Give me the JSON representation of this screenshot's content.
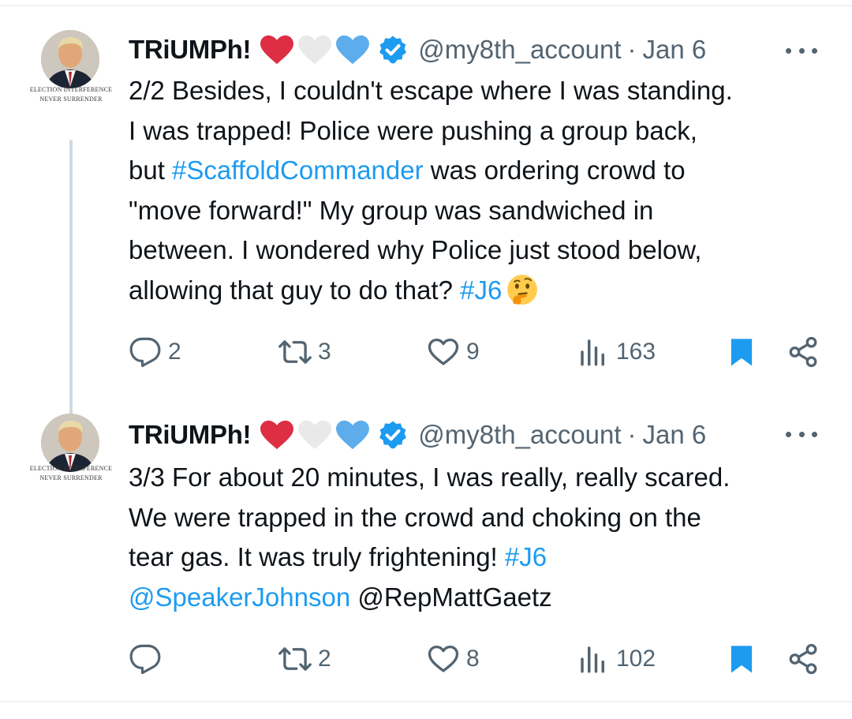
{
  "tweets": [
    {
      "display_name": "TRiUMPh!",
      "handle": "@my8th_account",
      "separator": "·",
      "date": "Jan 6",
      "avatar_caption_line1": "ELECTION INTERFERENCE",
      "avatar_caption_line2": "NEVER SURRENDER",
      "text_parts": {
        "p1": "2/2 Besides, I couldn't escape where I was standing.\nI was trapped! Police were pushing a group back,\nbut ",
        "hashtag1": "#ScaffoldCommander",
        "p2": " was ordering crowd to\n\"move forward!\" My group was sandwiched in\nbetween. I wondered why Police just stood below,\nallowing that guy to do that? ",
        "hashtag2": "#J6"
      },
      "stats": {
        "replies": "2",
        "retweets": "3",
        "likes": "9",
        "views": "163"
      }
    },
    {
      "display_name": "TRiUMPh!",
      "handle": "@my8th_account",
      "separator": "·",
      "date": "Jan 6",
      "avatar_caption_line1": "ELECTION INTERFERENCE",
      "avatar_caption_line2": "NEVER SURRENDER",
      "text_parts": {
        "p1": "3/3 For about 20 minutes, I was really, really scared.\nWe were trapped in the crowd and choking on the\ntear gas. It was truly frightening! ",
        "hashtag1": "#J6",
        "p2": "\n",
        "mention1": "@SpeakerJohnson",
        "p3": " @RepMattGaetz"
      },
      "stats": {
        "retweets": "2",
        "likes": "8",
        "views": "102"
      }
    }
  ],
  "icons": {
    "hearts": [
      "red-heart",
      "white-heart",
      "light-blue-heart"
    ],
    "verified": "verified-badge-icon",
    "more": "more-icon",
    "reply": "reply-icon",
    "retweet": "retweet-icon",
    "like": "like-icon",
    "views": "views-icon",
    "bookmark": "bookmark-icon",
    "share": "share-icon",
    "thinking": "thinking-face-emoji"
  },
  "colors": {
    "accent": "#1d9bf0",
    "text": "#0f1419",
    "muted": "#536471",
    "heart_red": "#dd2e44",
    "heart_white": "#e9e9e9",
    "heart_blue": "#5dadec"
  }
}
